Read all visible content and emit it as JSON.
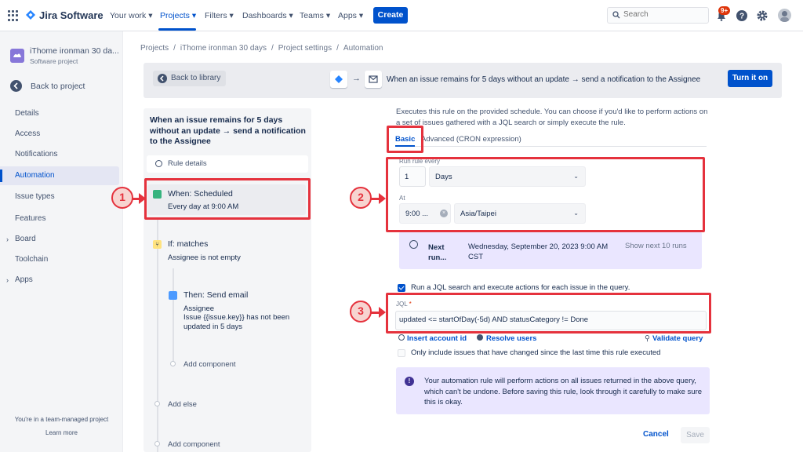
{
  "topnav": {
    "product": "Jira Software",
    "items": [
      "Your work",
      "Projects",
      "Filters",
      "Dashboards",
      "Teams",
      "Apps"
    ],
    "create": "Create",
    "search_placeholder": "Search",
    "notif_badge": "9+"
  },
  "sidebar": {
    "project_name": "iThome ironman 30 da...",
    "project_type": "Software project",
    "back": "Back to project",
    "items": [
      "Details",
      "Access",
      "Notifications",
      "Automation",
      "Issue types",
      "Features",
      "Board",
      "Toolchain",
      "Apps"
    ],
    "footer": "You're in a team-managed project",
    "learn": "Learn more"
  },
  "breadcrumb": [
    "Projects",
    "iThome ironman 30 days",
    "Project settings",
    "Automation"
  ],
  "banner": {
    "back_label": "Back to library",
    "summary": "When an issue remains for 5 days without an update → send a notification to the Assignee",
    "turn_on": "Turn it on"
  },
  "rule": {
    "title": "When an issue remains for 5 days without an update → send a notification to the Assignee",
    "details": "Rule details",
    "trigger_title": "When: Scheduled",
    "trigger_sub": "Every day at 9:00 AM",
    "condition_title": "If: matches",
    "condition_sub": "Assignee is not empty",
    "action_title": "Then: Send email",
    "action_sub1": "Assignee",
    "action_sub2": "Issue {{issue.key}} has not been updated in 5 days",
    "add_component": "Add component",
    "add_else": "Add else",
    "add_component_2": "Add component"
  },
  "config": {
    "description": "Executes this rule on the provided schedule. You can choose if you'd like to perform actions on a set of issues gathered with a JQL search or simply execute the rule.",
    "tab_basic": "Basic",
    "tab_advanced": "Advanced (CRON expression)",
    "run_every_label": "Run rule every",
    "run_every_value": "1",
    "unit": "Days",
    "at_label": "At",
    "time": "9:00 ...",
    "timezone": "Asia/Taipei",
    "next_label": "Next run...",
    "next_value": "Wednesday, September 20, 2023 9:00 AM CST",
    "show_next": "Show next 10 runs",
    "jql_check": "Run a JQL search and execute actions for each issue in the query.",
    "jql_label": "JQL",
    "jql_value": "updated <= startOfDay(-5d) AND statusCategory != Done",
    "insert_account": "Insert account id",
    "resolve_users": "Resolve users",
    "validate": "Validate query",
    "only_changed": "Only include issues that have changed since the last time this rule executed",
    "warning": "Your automation rule will perform actions on all issues returned in the above query, which can't be undone. Before saving this rule, look through it carefully to make sure this is okay.",
    "cancel": "Cancel",
    "save": "Save"
  },
  "annotations": [
    "1",
    "2",
    "3"
  ],
  "colors": {
    "brand": "#0052cc",
    "highlight": "#e5323d",
    "info_bg": "#eae6ff"
  }
}
